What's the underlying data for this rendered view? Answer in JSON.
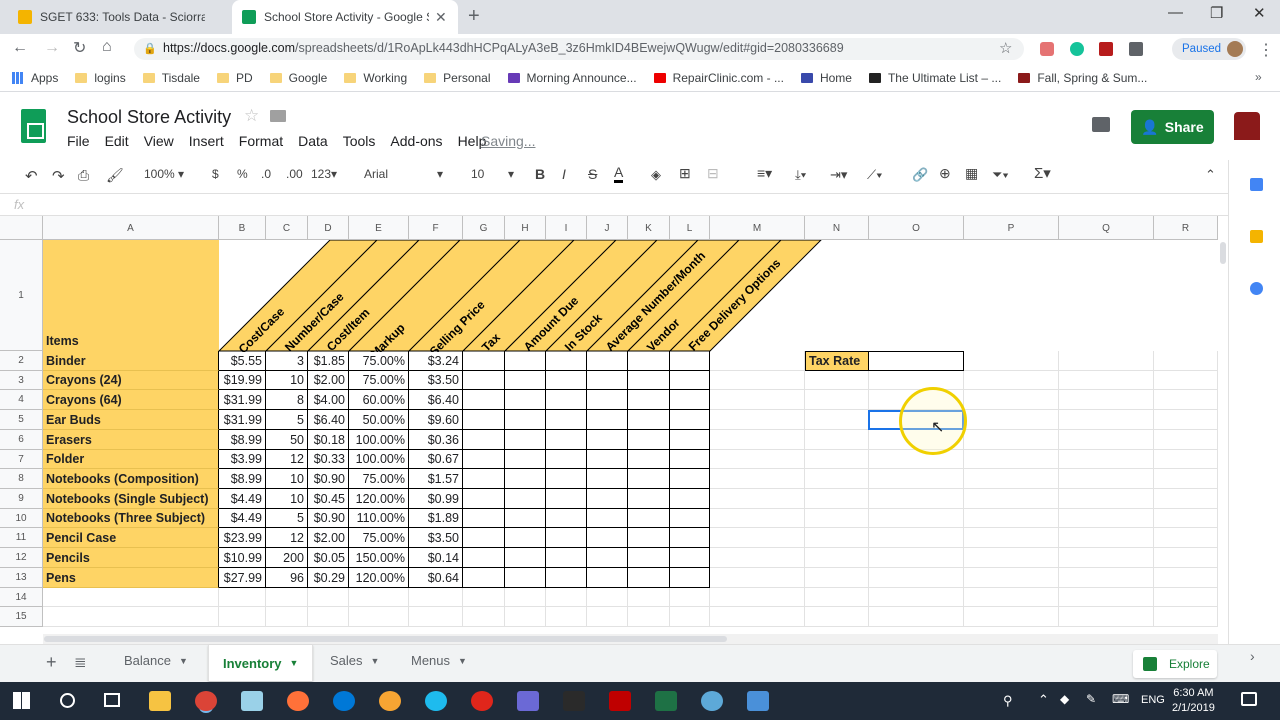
{
  "browser": {
    "tabs": [
      {
        "title": "SGET 633: Tools Data - Sciorra - G",
        "active": false
      },
      {
        "title": "School Store Activity - Google Sh",
        "active": true
      }
    ],
    "url_main": "https://docs.google.com",
    "url_rest": "/spreadsheets/d/1RoApLk443dhHCPqALyA3eB_3z6HmkID4BEwejwQWugw/edit#gid=2080336689",
    "profile_status": "Paused",
    "bookmarks": [
      "Apps",
      "logins",
      "Tisdale",
      "PD",
      "Google",
      "Working",
      "Personal",
      "Morning Announce...",
      "RepairClinic.com - ...",
      "Home",
      "The Ultimate List – ...",
      "Fall, Spring & Sum..."
    ]
  },
  "sheets": {
    "title": "School Store Activity",
    "menu": [
      "File",
      "Edit",
      "View",
      "Insert",
      "Format",
      "Data",
      "Tools",
      "Add-ons",
      "Help"
    ],
    "save_status": "Saving...",
    "share_label": "Share",
    "toolbar": {
      "zoom": "100%",
      "currency": "$",
      "percent": "%",
      "dec_less": ".0",
      "dec_more": ".00",
      "format_more": "123",
      "font": "Arial",
      "font_size": "10"
    },
    "fx_label": "fx",
    "columns": [
      "A",
      "B",
      "C",
      "D",
      "E",
      "F",
      "G",
      "H",
      "I",
      "J",
      "K",
      "L",
      "M",
      "N",
      "O",
      "P",
      "Q",
      "R"
    ],
    "row_numbers": [
      "1",
      "2",
      "3",
      "4",
      "5",
      "6",
      "7",
      "8",
      "9",
      "10",
      "11",
      "12",
      "13",
      "14",
      "15"
    ],
    "header_items_label": "Items",
    "diagonal_headers": [
      "Cost/Case",
      "Number/Case",
      "Cost/Item",
      "Markup",
      "Selling Price",
      "Tax",
      "Amount Due",
      "In Stock",
      "Average Number/Month",
      "Vendor",
      "Free Delivery Options"
    ],
    "rows": [
      {
        "item": "Binder",
        "cost_case": "$5.55",
        "number_case": "3",
        "cost_item": "$1.85",
        "markup": "75.00%",
        "price": "$3.24"
      },
      {
        "item": "Crayons (24)",
        "cost_case": "$19.99",
        "number_case": "10",
        "cost_item": "$2.00",
        "markup": "75.00%",
        "price": "$3.50"
      },
      {
        "item": "Crayons (64)",
        "cost_case": "$31.99",
        "number_case": "8",
        "cost_item": "$4.00",
        "markup": "60.00%",
        "price": "$6.40"
      },
      {
        "item": "Ear Buds",
        "cost_case": "$31.99",
        "number_case": "5",
        "cost_item": "$6.40",
        "markup": "50.00%",
        "price": "$9.60"
      },
      {
        "item": "Erasers",
        "cost_case": "$8.99",
        "number_case": "50",
        "cost_item": "$0.18",
        "markup": "100.00%",
        "price": "$0.36"
      },
      {
        "item": "Folder",
        "cost_case": "$3.99",
        "number_case": "12",
        "cost_item": "$0.33",
        "markup": "100.00%",
        "price": "$0.67"
      },
      {
        "item": "Notebooks (Composition)",
        "cost_case": "$8.99",
        "number_case": "10",
        "cost_item": "$0.90",
        "markup": "75.00%",
        "price": "$1.57"
      },
      {
        "item": "Notebooks (Single Subject)",
        "cost_case": "$4.49",
        "number_case": "10",
        "cost_item": "$0.45",
        "markup": "120.00%",
        "price": "$0.99"
      },
      {
        "item": "Notebooks (Three Subject)",
        "cost_case": "$4.49",
        "number_case": "5",
        "cost_item": "$0.90",
        "markup": "110.00%",
        "price": "$1.89"
      },
      {
        "item": "Pencil Case",
        "cost_case": "$23.99",
        "number_case": "12",
        "cost_item": "$2.00",
        "markup": "75.00%",
        "price": "$3.50"
      },
      {
        "item": "Pencils",
        "cost_case": "$10.99",
        "number_case": "200",
        "cost_item": "$0.05",
        "markup": "150.00%",
        "price": "$0.14"
      },
      {
        "item": "Pens",
        "cost_case": "$27.99",
        "number_case": "96",
        "cost_item": "$0.29",
        "markup": "120.00%",
        "price": "$0.64"
      }
    ],
    "tax_rate_label": "Tax Rate",
    "sheet_tabs": [
      "Balance",
      "Inventory",
      "Sales",
      "Menus"
    ],
    "active_sheet": "Inventory",
    "explore_label": "Explore"
  },
  "taskbar": {
    "time": "6:30 AM",
    "date": "2/1/2019",
    "lang": "ENG"
  }
}
